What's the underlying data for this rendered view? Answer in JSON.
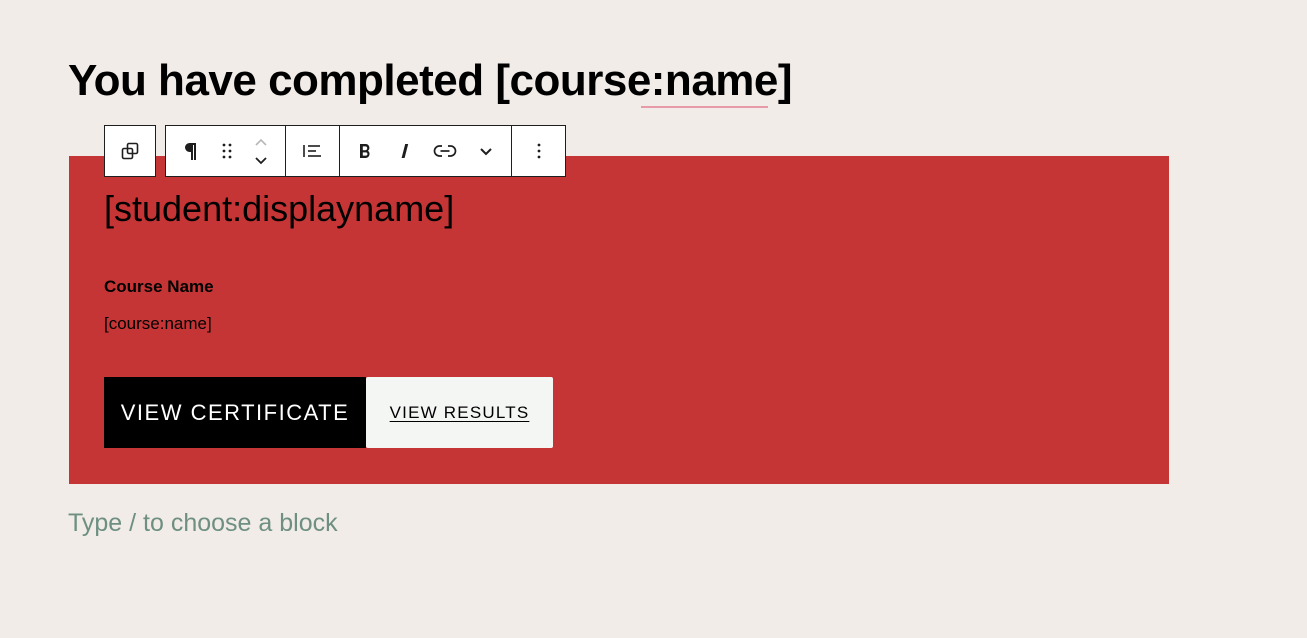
{
  "page": {
    "title": "You have completed [course:name]",
    "background_color": "#f1ece8"
  },
  "toolbar": {
    "icons": {
      "transform": "duplicate-squares-icon",
      "paragraph": "pilcrow-icon",
      "drag": "drag-handle-icon",
      "move_up": "chevron-up-icon",
      "move_down": "chevron-down-icon",
      "align": "align-left-icon",
      "bold": "bold-icon",
      "italic": "italic-icon",
      "link": "link-icon",
      "more_rich_text": "chevron-down-icon",
      "options": "vertical-ellipsis-icon"
    }
  },
  "certificate_block": {
    "background_color": "#c63535",
    "student_name": "[student:displayname]",
    "course_label": "Course Name",
    "course_value": "[course:name]",
    "buttons": {
      "view_certificate": "VIEW CERTIFICATE",
      "view_results": "VIEW RESULTS"
    }
  },
  "editor": {
    "placeholder": "Type / to choose a block",
    "placeholder_color": "#6e8f82"
  }
}
